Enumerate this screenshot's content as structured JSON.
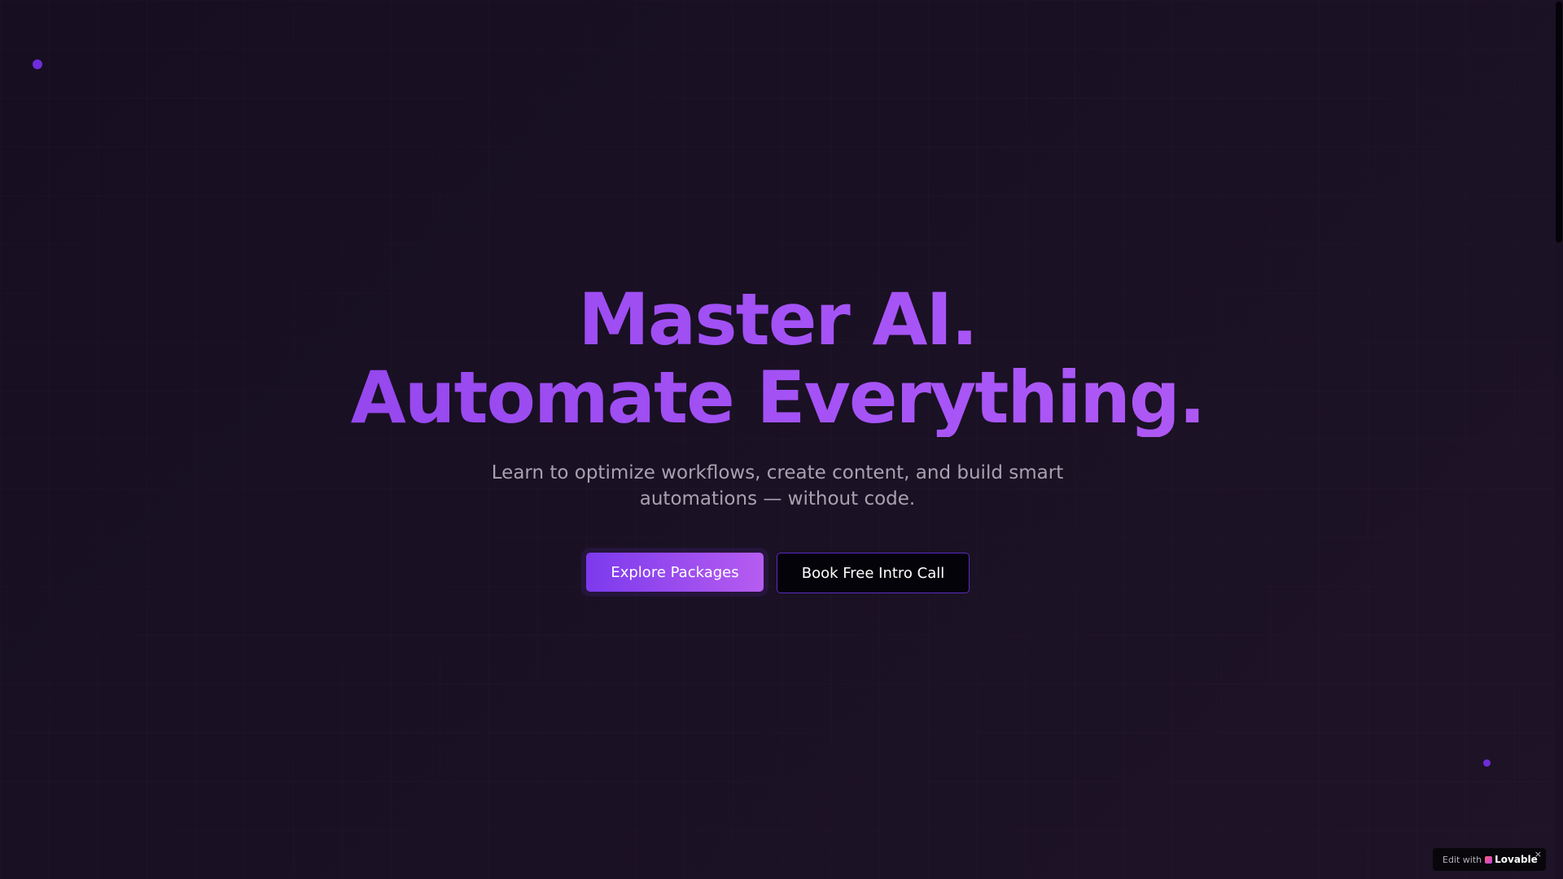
{
  "hero": {
    "headline_line1": "Master AI.",
    "headline_line2": "Automate Everything.",
    "subtitle": "Learn to optimize workflows, create content, and build smart automations — without code.",
    "primary_button_label": "Explore Packages",
    "secondary_button_label": "Book Free Intro Call"
  },
  "badge": {
    "prefix": "Edit with",
    "brand": "Lovable",
    "close_glyph": "×",
    "logo_icon": "lovable-heart-icon"
  },
  "colors": {
    "background": "#1a1124",
    "accent_start": "#7c3aed",
    "accent_end": "#b65cf0",
    "subtitle_text": "#a8a2b0",
    "dot": "#6d2ed9"
  }
}
